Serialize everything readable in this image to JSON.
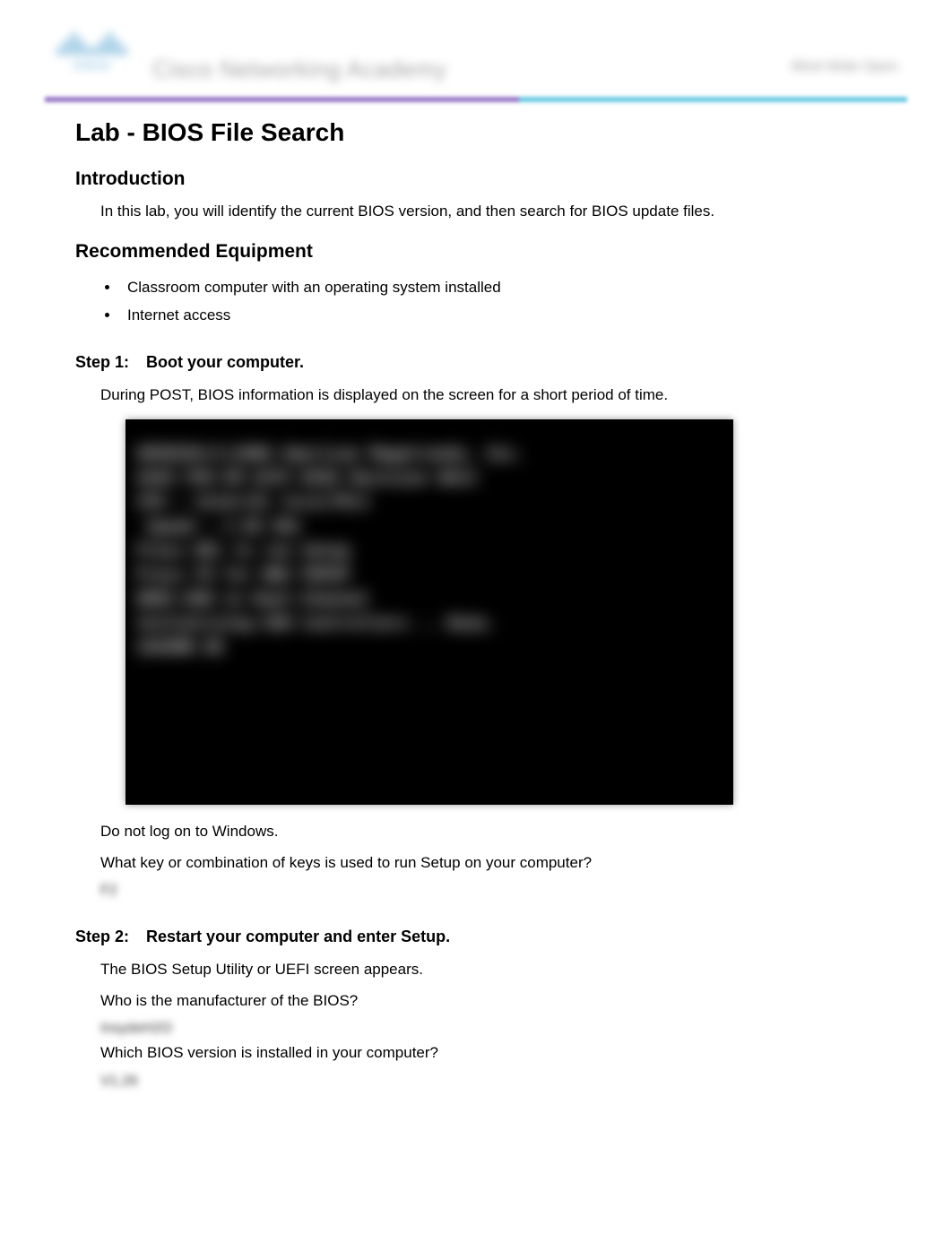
{
  "header": {
    "brand_bars": [
      10,
      18,
      26,
      18,
      10,
      10,
      18,
      26,
      18,
      10
    ],
    "brand_word": "cisco",
    "title": "Cisco Networking Academy",
    "right_text": "Mind Wide Open"
  },
  "doc": {
    "title": "Lab - BIOS File Search",
    "intro_heading": "Introduction",
    "intro_text": "In this lab, you will identify the current BIOS version, and then search for BIOS update files.",
    "equipment_heading": "Recommended Equipment",
    "equipment_items": [
      "Classroom computer with an operating system installed",
      "Internet access"
    ],
    "step1": {
      "num": "Step 1:",
      "title": "Boot your computer.",
      "text1": "During POST, BIOS information is displayed on the screen for a short period of time.",
      "post_lines": [
        "AMIBIOS(C)2006 American Megatrends, Inc.",
        "ASUS P5K-VM ACPI BIOS Revision 0613",
        "CPU : Intel(R) Core(TM)2",
        " Speed : 2.66 GHz",
        "",
        "Press DEL to run Setup",
        "Press F8 for BBS POPUP",
        "DDR2-800 in Dual-Channel",
        "Initializing USB Controllers .. Done.",
        "2048MB OK"
      ],
      "text2": "Do not log on to Windows.",
      "question": "What key or combination of keys is used to run Setup on your computer?",
      "answer": "F2"
    },
    "step2": {
      "num": "Step 2:",
      "title": "Restart your computer and enter Setup.",
      "text1": "The BIOS Setup Utility or UEFI screen appears.",
      "q1": "Who is the manufacturer of the BIOS?",
      "a1": "InsydeH2O",
      "q2": "Which BIOS version is installed in your computer?",
      "a2": "V1.26"
    }
  }
}
